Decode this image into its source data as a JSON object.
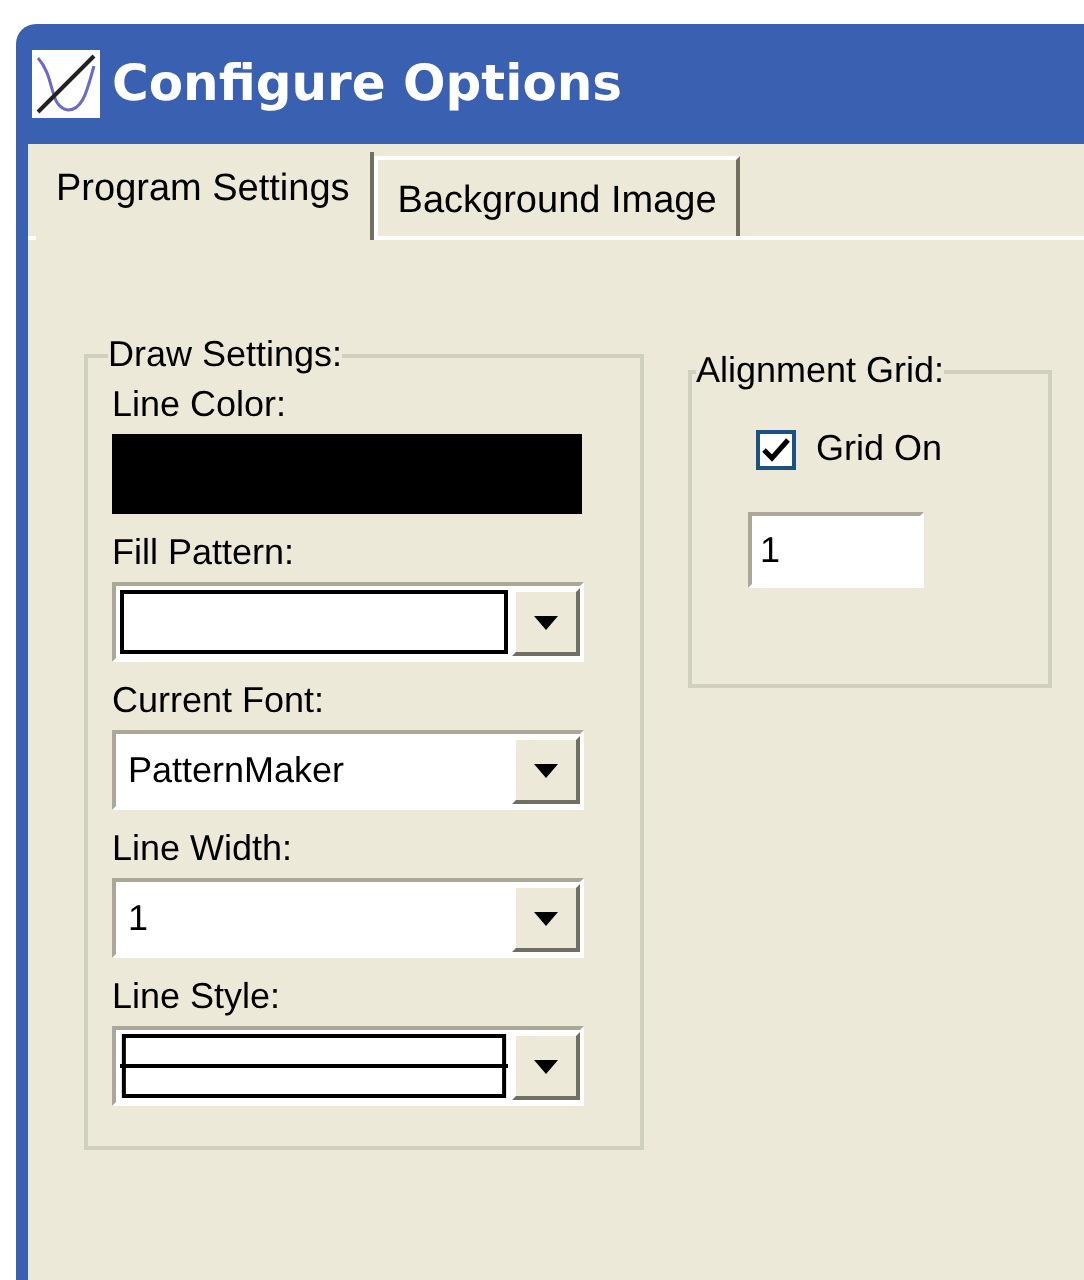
{
  "window": {
    "title": "Configure Options"
  },
  "tabs": [
    {
      "label": "Program Settings",
      "selected": true
    },
    {
      "label": "Background Image",
      "selected": false
    }
  ],
  "draw_settings": {
    "title": "Draw Settings:",
    "fields": [
      {
        "kind": "color",
        "label": "Line Color:",
        "color": "#000000"
      },
      {
        "kind": "pattern",
        "label": "Fill Pattern:"
      },
      {
        "kind": "text",
        "label": "Current Font:",
        "value": "PatternMaker"
      },
      {
        "kind": "text",
        "label": "Line Width:",
        "value": "1"
      },
      {
        "kind": "line",
        "label": "Line Style:"
      }
    ]
  },
  "alignment_grid": {
    "title": "Alignment Grid:",
    "checkbox": {
      "label": "Grid On",
      "checked": true
    },
    "spacing": {
      "value": "1"
    }
  }
}
